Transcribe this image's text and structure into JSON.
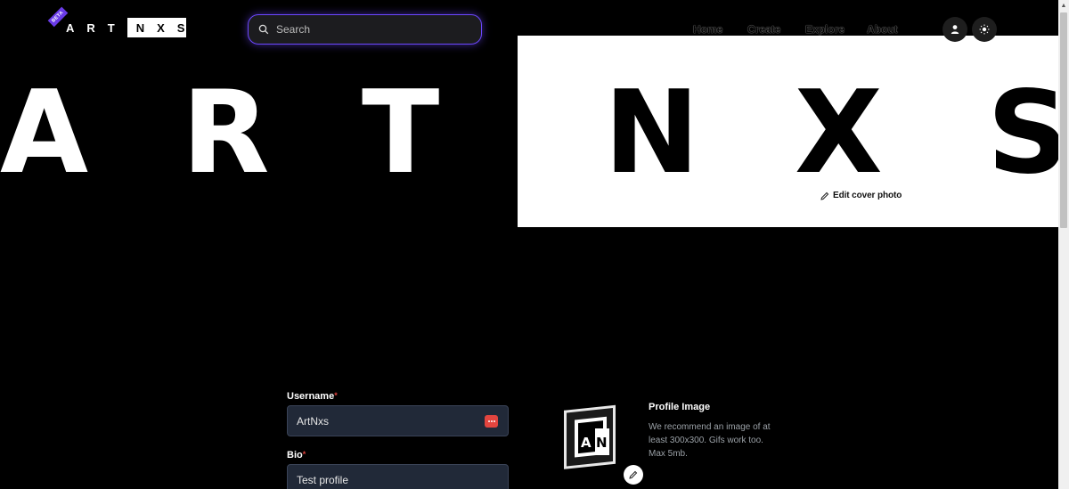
{
  "header": {
    "beta_badge": "BETA",
    "logo_left": "ART",
    "logo_right": "NXS",
    "search_placeholder": "Search",
    "nav": [
      {
        "label": "Home"
      },
      {
        "label": "Create"
      },
      {
        "label": "Explore"
      },
      {
        "label": "About"
      }
    ],
    "profile_icon": "user-icon",
    "theme_icon": "sun-icon"
  },
  "cover": {
    "letters": [
      "A",
      "R",
      "T",
      "N",
      "X",
      "S"
    ],
    "edit_label": "Edit cover photo",
    "edit_icon": "pencil-icon"
  },
  "form": {
    "username_label": "Username",
    "username_value": "ArtNxs",
    "bio_label": "Bio",
    "bio_value": "Test profile",
    "required_mark": "*"
  },
  "profile_image": {
    "title": "Profile Image",
    "description": "We recommend an image of at least 300x300. Gifs work too. Max 5mb.",
    "thumb_text_left": "A",
    "thumb_text_right": "N"
  },
  "colors": {
    "accent": "#6c47ff",
    "beta": "#6a3be8",
    "required": "#e0413c",
    "input_bg": "#212938"
  }
}
